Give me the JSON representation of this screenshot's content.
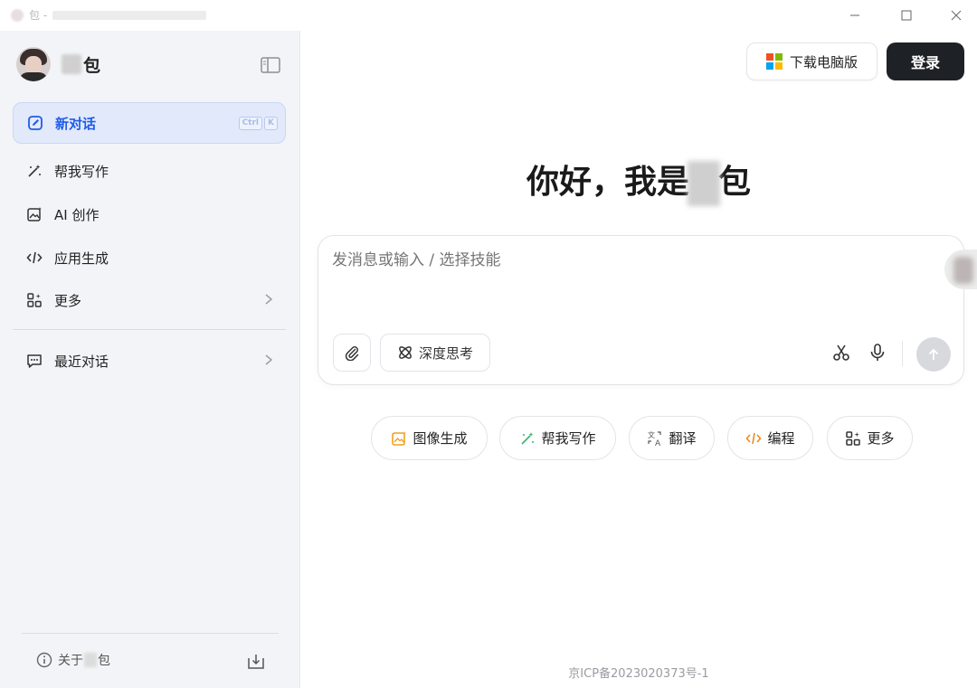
{
  "window": {
    "title_suffix": "包 - "
  },
  "sidebar": {
    "brand_name": "包",
    "new_chat": {
      "label": "新对话",
      "shortcut_ctrl": "Ctrl",
      "shortcut_key": "K"
    },
    "items": [
      {
        "label": "帮我写作",
        "icon": "pen-sparkle-icon"
      },
      {
        "label": "AI 创作",
        "icon": "image-sparkle-icon"
      },
      {
        "label": "应用生成",
        "icon": "code-icon"
      },
      {
        "label": "更多",
        "icon": "grid-icon"
      }
    ],
    "recent": {
      "label": "最近对话",
      "icon": "chat-icon"
    },
    "about": {
      "prefix": "关于",
      "suffix": "包"
    }
  },
  "header": {
    "download_label": "下载电脑版",
    "login_label": "登录"
  },
  "hero": {
    "greeting": "你好，我是",
    "greeting_tail": "包"
  },
  "composer": {
    "placeholder": "发消息或输入 / 选择技能",
    "deep_think_label": "深度思考"
  },
  "skills": [
    {
      "label": "图像生成",
      "icon": "image-gen-icon",
      "color": "#f0a020"
    },
    {
      "label": "帮我写作",
      "icon": "pen-sparkle-icon",
      "color": "#3bb36b"
    },
    {
      "label": "翻译",
      "icon": "translate-icon",
      "color": "#555555"
    },
    {
      "label": "编程",
      "icon": "code-icon",
      "color": "#f08a1c"
    },
    {
      "label": "更多",
      "icon": "grid-icon",
      "color": "#333333"
    }
  ],
  "footer": {
    "icp": "京ICP备2023020373号-1"
  },
  "colors": {
    "accent": "#1f5ce6",
    "sidebar_bg": "#f3f4f7",
    "login_bg": "#1e2226"
  }
}
